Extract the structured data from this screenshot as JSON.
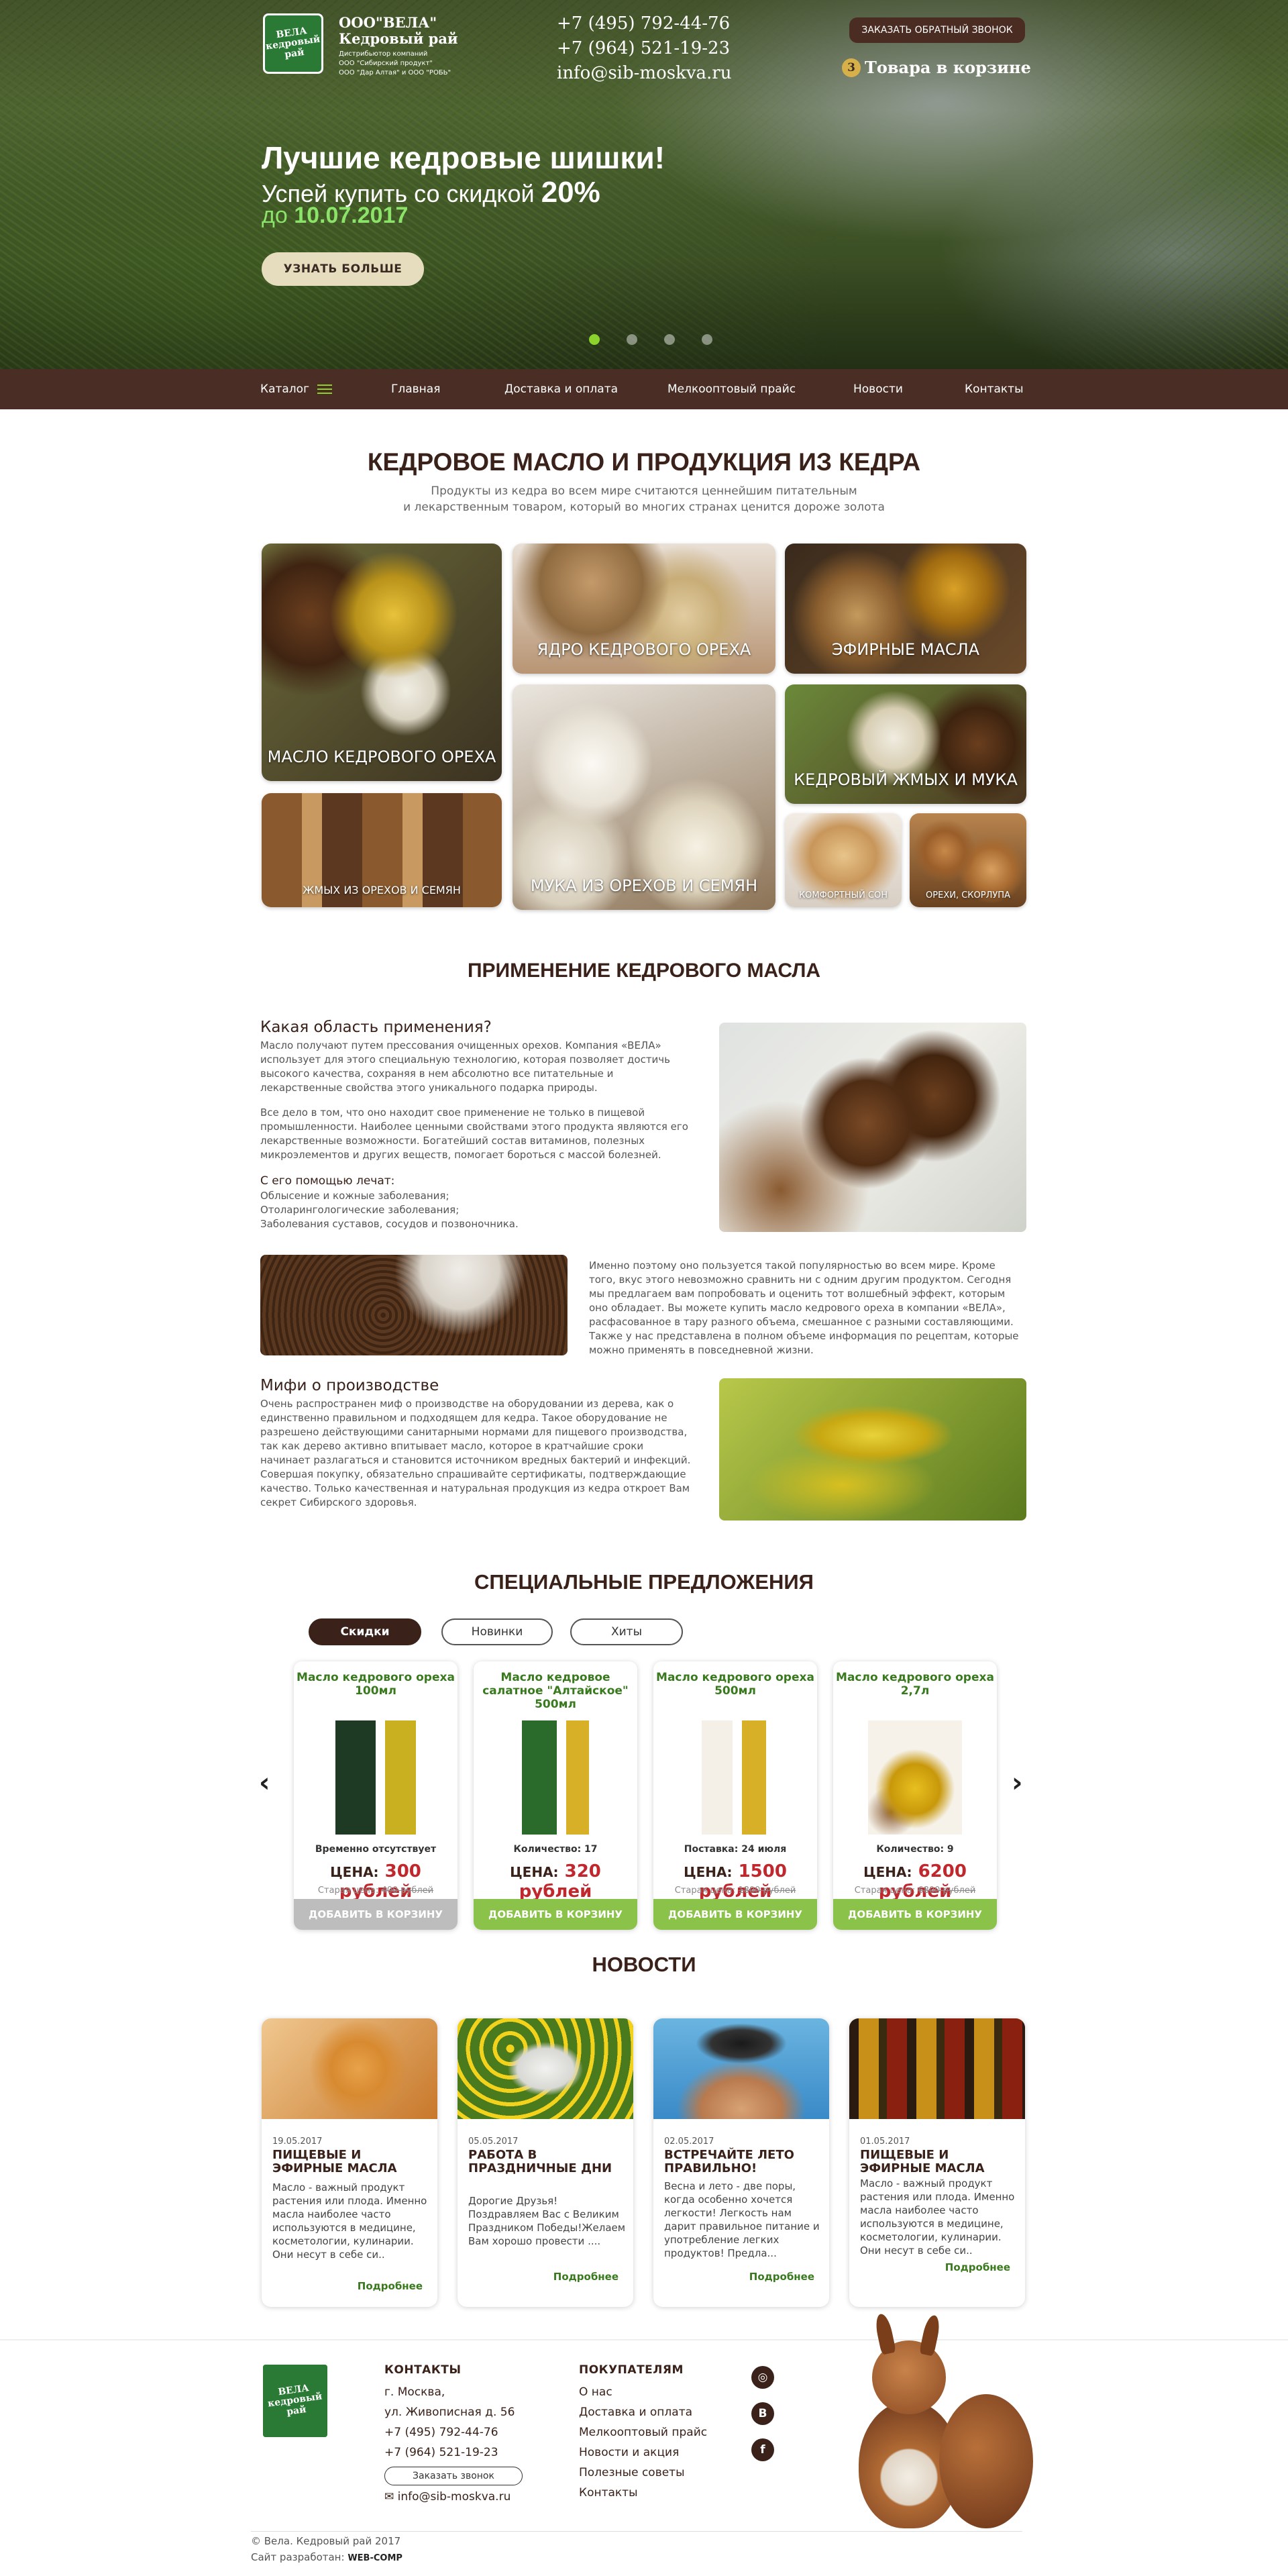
{
  "header": {
    "logo_text": "ВЕЛА\nкедровый рай",
    "brand": "ООО\"ВЕЛА\"",
    "brand2": "Кедровый рай",
    "lines": [
      "Дистрибьютор компаний",
      "ООО \"Сибирский продукт\"",
      "ООО \"Дар Алтая\" и ООО \"РОБЬ\""
    ],
    "phone1": "+7 (495) 792-44-76",
    "phone2": "+7 (964) 521-19-23",
    "email": "info@sib-moskva.ru",
    "callback": "ЗАКАЗАТЬ ОБРАТНЫЙ ЗВОНОК",
    "cart_count": "3",
    "cart_text": "Товара в корзине"
  },
  "hero": {
    "title": "Лучшие кедровые шишки!",
    "sub": "Успей купить со скидкой",
    "discount": "20%",
    "date_prefix": "до",
    "date": "10.07.2017",
    "button": "УЗНАТЬ БОЛЬШЕ",
    "slides": 4,
    "active_slide": 1
  },
  "nav": {
    "catalog": "Каталог",
    "items": [
      "Главная",
      "Доставка и оплата",
      "Мелкооптовый прайс",
      "Новости",
      "Контакты"
    ]
  },
  "categories": {
    "title": "КЕДРОВОЕ МАСЛО И ПРОДУКЦИЯ ИЗ КЕДРА",
    "lead1": "Продукты из кедра во всем мире считаются ценнейшим питательным",
    "lead2": "и лекарственным товаром,  который во многих странах ценится дороже золота",
    "tiles": [
      "МАСЛО КЕДРОВОГО ОРЕХА",
      "ЯДРО КЕДРОВОГО ОРЕХА",
      "ЭФИРНЫЕ МАСЛА",
      "КЕДРОВЫЙ ЖМЫХ И МУКА",
      "ЖМЫХ ИЗ ОРЕХОВ И СЕМЯН",
      "МУКА ИЗ ОРЕХОВ И СЕМЯН",
      "КОМФОРТНЫЙ СОН",
      "ОРЕХИ, СКОРЛУПА"
    ]
  },
  "usage": {
    "title": "ПРИМЕНЕНИЕ КЕДРОВОГО МАСЛА",
    "q1": "Какая область применения?",
    "p1": "Масло получают путем прессования очищенных орехов. Компания «ВЕЛА» использует для этого специальную технологию, которая позволяет достичь высокого качества, сохраняя в нем абсолютно все питательные и лекарственные свойства этого уникального подарка природы.",
    "p2": "Все дело в том, что оно находит свое применение не только в пищевой промышленности. Наиболее ценными свойствами этого продукта являются его лекарственные возможности. Богатейший состав витаминов, полезных микроэлементов и других веществ, помогает бороться с массой болезней.",
    "treat_title": "С его помощью лечат:",
    "treat": [
      "Облысение и кожные заболевания;",
      "Отоларингологические заболевания;",
      "Заболевания суставов, сосудов и позвоночника."
    ],
    "p3": "Именно поэтому оно пользуется такой популярностью во всем мире. Кроме того, вкус этого невозможно сравнить ни с одним другим продуктом. Сегодня мы предлагаем вам попробовать и оценить тот волшебный эффект, которым оно обладает. Вы можете купить масло кедрового ореха в компании «ВЕЛА», расфасованное в тару разного объема, смешанное с разными составляющими. Также у нас представлена в полном объеме информация по рецептам, которые можно применять в повседневной жизни.",
    "q2": "Мифи о производстве",
    "p4": "Очень распространен миф о производстве на оборудовании из дерева, как о единственно правильном и подходящем для кедра. Такое оборудование не разрешено действующими санитарными нормами для пищевого производства, так как дерево активно впитывает масло, которое в кратчайшие сроки начинает разлагаться и становится источником вредных бактерий и инфекций. Совершая покупку, обязательно спрашивайте сертификаты, подтверждающие качество. Только качественная и натуральная продукция из кедра откроет Вам секрет Сибирского здоровья."
  },
  "offers": {
    "title": "СПЕЦИАЛЬНЫЕ ПРЕДЛОЖЕНИЯ",
    "tabs": [
      "Скидки",
      "Новинки",
      "Хиты"
    ],
    "price_label": "ЦЕНА:",
    "old_label": "Старая цена:",
    "cart_btn": "ДОБАВИТЬ В КОРЗИНУ",
    "products": [
      {
        "name": "Масло кедрового ореха 100мл",
        "status": "Временно отсутствует",
        "price": "300 рублей",
        "old": "400 рублей"
      },
      {
        "name": "Масло кедровое салатное \"Алтайское\" 500мл",
        "status": "Количество: 17",
        "price": "320 рублей",
        "old": ""
      },
      {
        "name": "Масло кедрового ореха 500мл",
        "status": "Поставка: 24 июля",
        "price": "1500 рублей",
        "old": "1800 рублей"
      },
      {
        "name": "Масло кедрового ореха 2,7л",
        "status": "Количество: 9",
        "price": "6200 рублей",
        "old": "6800 рублей"
      }
    ]
  },
  "news": {
    "title": "НОВОСТИ",
    "more": "Подробнее",
    "items": [
      {
        "date": "19.05.2017",
        "title": "ПИЩЕВЫЕ И ЭФИРНЫЕ МАСЛА",
        "text": "Масло - важный продукт растения или плода. Именно масла наиболее часто используются в медицине, косметологии, кулинарии. Они несут в себе си.."
      },
      {
        "date": "05.05.2017",
        "title": "РАБОТА В ПРАЗДНИЧНЫЕ ДНИ",
        "text": "Дорогие Друзья!Поздравляем Вас с Великим Праздником Победы!Желаем Вам хорошо провести ...."
      },
      {
        "date": "02.05.2017",
        "title": "ВСТРЕЧАЙТЕ ЛЕТО ПРАВИЛЬНО!",
        "text": "Весна и лето - две поры, когда особенно хочется легкости! Легкость нам дарит правильное питание и употребление легких продуктов! Предла..."
      },
      {
        "date": "01.05.2017",
        "title": "ПИЩЕВЫЕ И ЭФИРНЫЕ МАСЛА",
        "text": "Масло - важный продукт растения или плода. Именно масла наиболее часто используются в медицине, косметологии, кулинарии. Они несут в себе си.."
      }
    ]
  },
  "footer": {
    "contacts_title": "КОНТАКТЫ",
    "city": "г. Москва,",
    "street": "ул. Живописная д. 56",
    "phone1": "+7 (495) 792-44-76",
    "phone2": "+7 (964) 521-19-23",
    "callback": "Заказать звонок",
    "email": "info@sib-moskva.ru",
    "buyers_title": "ПОКУПАТЕЛЯМ",
    "buyers": [
      "О нас",
      "Доставка и оплата",
      "Мелкооптовый прайс",
      "Новости и акция",
      "Полезные советы",
      "Контакты"
    ],
    "copyright": "© Вела. Кедровый рай 2017",
    "dev_label": "Сайт разработан:",
    "dev": "WEB-COMP",
    "social": [
      "instagram-icon",
      "vk-icon",
      "facebook-icon"
    ]
  }
}
